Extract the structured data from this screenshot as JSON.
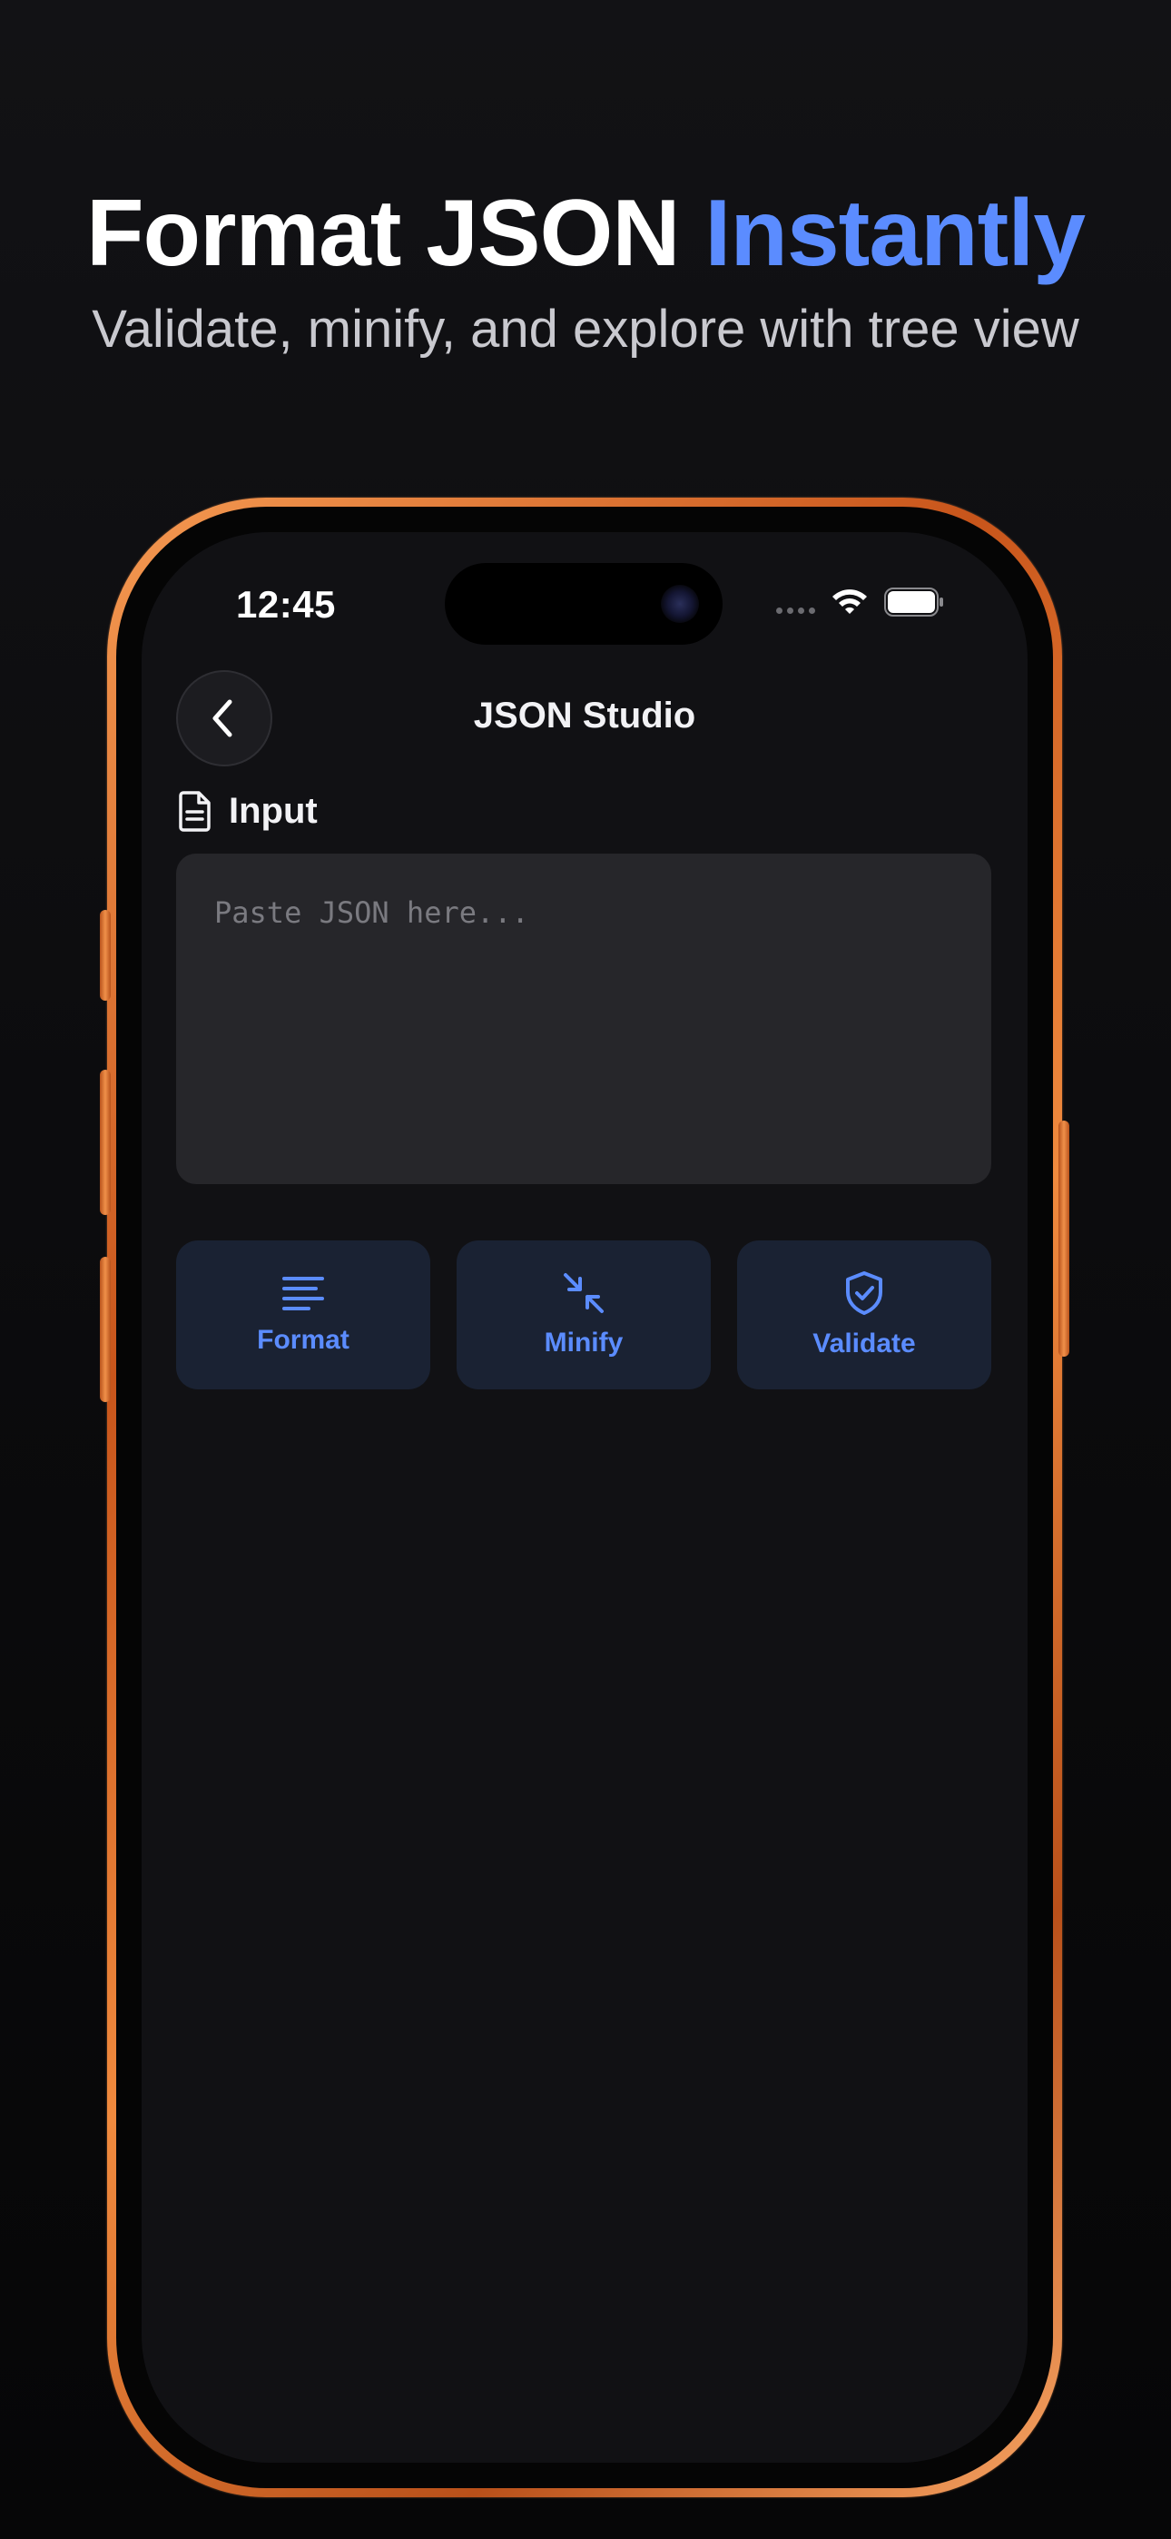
{
  "marketing": {
    "headline_main": "Format JSON",
    "headline_accent": "Instantly",
    "subtitle": "Validate, minify, and explore with tree view",
    "accent_color": "#5b8cff"
  },
  "status_bar": {
    "time": "12:45",
    "icons": [
      "cellular-dots-icon",
      "wifi-icon",
      "battery-icon"
    ]
  },
  "nav": {
    "back_icon": "chevron-left-icon",
    "title": "JSON Studio"
  },
  "input_section": {
    "icon": "document-icon",
    "label": "Input",
    "placeholder": "Paste JSON here...",
    "value": ""
  },
  "actions": [
    {
      "label": "Format",
      "icon": "align-left-icon"
    },
    {
      "label": "Minify",
      "icon": "collapse-arrows-icon"
    },
    {
      "label": "Validate",
      "icon": "shield-check-icon"
    }
  ],
  "colors": {
    "background": "#111114",
    "input_bg": "#26262a",
    "button_bg": "#1a2233",
    "button_text": "#5b8cff",
    "phone_frame": "#f08a3e"
  }
}
